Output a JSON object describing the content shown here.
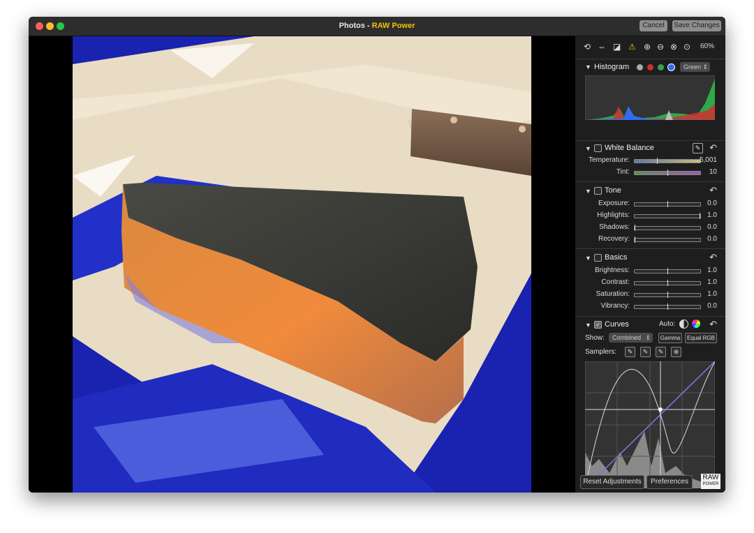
{
  "window": {
    "title_prefix": "Photos - ",
    "app_name": "RAW Power",
    "cancel_label": "Cancel",
    "save_label": "Save Changes"
  },
  "toolbar": {
    "zoom": "60%",
    "icons": [
      "rotate-icon",
      "flip-icon",
      "crop-icon",
      "warning-icon",
      "zoom-in-icon",
      "zoom-out-icon",
      "zoom-fit-icon",
      "zoom-100-icon"
    ]
  },
  "histogram": {
    "title": "Histogram",
    "channel": "Green",
    "dot_colors": [
      "#aaaaaa",
      "#d0302b",
      "#2ea84a",
      "#2f6df0"
    ]
  },
  "white_balance": {
    "title": "White Balance",
    "rows": [
      {
        "label": "Temperature:",
        "value": "5,001"
      },
      {
        "label": "Tint:",
        "value": "10"
      }
    ]
  },
  "tone": {
    "title": "Tone",
    "rows": [
      {
        "label": "Exposure:",
        "value": "0.0"
      },
      {
        "label": "Highlights:",
        "value": "1.0"
      },
      {
        "label": "Shadows:",
        "value": "0.0"
      },
      {
        "label": "Recovery:",
        "value": "0.0"
      }
    ]
  },
  "basics": {
    "title": "Basics",
    "rows": [
      {
        "label": "Brightness:",
        "value": "1.0"
      },
      {
        "label": "Contrast:",
        "value": "1.0"
      },
      {
        "label": "Saturation:",
        "value": "1.0"
      },
      {
        "label": "Vibrancy:",
        "value": "0.0"
      }
    ]
  },
  "curves": {
    "title": "Curves",
    "auto_label": "Auto:",
    "show_label": "Show:",
    "show_value": "Combined",
    "gamma_label": "Gamma",
    "equal_rgb_label": "Equal RGB",
    "samplers_label": "Samplers:"
  },
  "footer": {
    "reset_label": "Reset Adjustments",
    "prefs_label": "Preferences",
    "logo_top": "RAW",
    "logo_bottom": "POWER"
  }
}
